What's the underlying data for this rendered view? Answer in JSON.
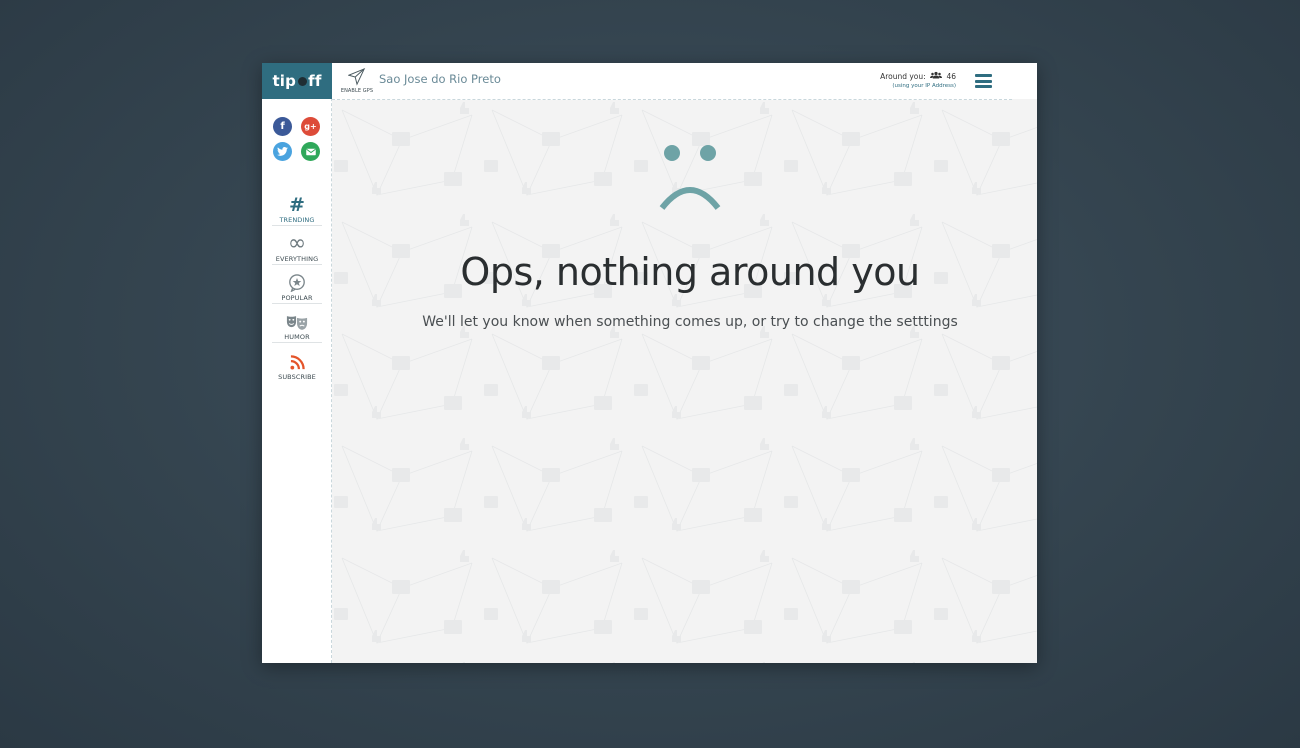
{
  "brand": {
    "logo_left": "tip",
    "logo_right": "ff"
  },
  "share": [
    {
      "name": "facebook",
      "glyph": "f",
      "color": "#3b5998"
    },
    {
      "name": "google-plus",
      "glyph": "g+",
      "color": "#dd4b39"
    },
    {
      "name": "twitter",
      "glyph": "t",
      "color": "#4aa3df"
    },
    {
      "name": "email",
      "glyph": "✉",
      "color": "#2fa85a"
    }
  ],
  "nav": [
    {
      "label": "TRENDING",
      "icon": "hashtag-icon",
      "glyph": "#",
      "active": true
    },
    {
      "label": "EVERYTHING",
      "icon": "infinity-icon",
      "glyph": "∞",
      "active": false
    },
    {
      "label": "POPULAR",
      "icon": "star-bubble-icon",
      "glyph": "★",
      "active": false
    },
    {
      "label": "HUMOR",
      "icon": "masks-icon",
      "glyph": "☺",
      "active": false
    },
    {
      "label": "SUBSCRIBE",
      "icon": "rss-icon",
      "glyph": "◔",
      "active": false
    }
  ],
  "header": {
    "gps_label": "ENABLE GPS",
    "city": "Sao Jose do Rio Preto",
    "around_label": "Around you:",
    "around_count": "46",
    "around_note": "(using your IP Address)"
  },
  "empty_state": {
    "title": "Ops, nothing around you",
    "message": "We'll let you know when something comes up, or try to change the setttings"
  },
  "colors": {
    "accent": "#2f6d80",
    "sad_face": "#6ea3a6",
    "rss": "#e4542a"
  }
}
